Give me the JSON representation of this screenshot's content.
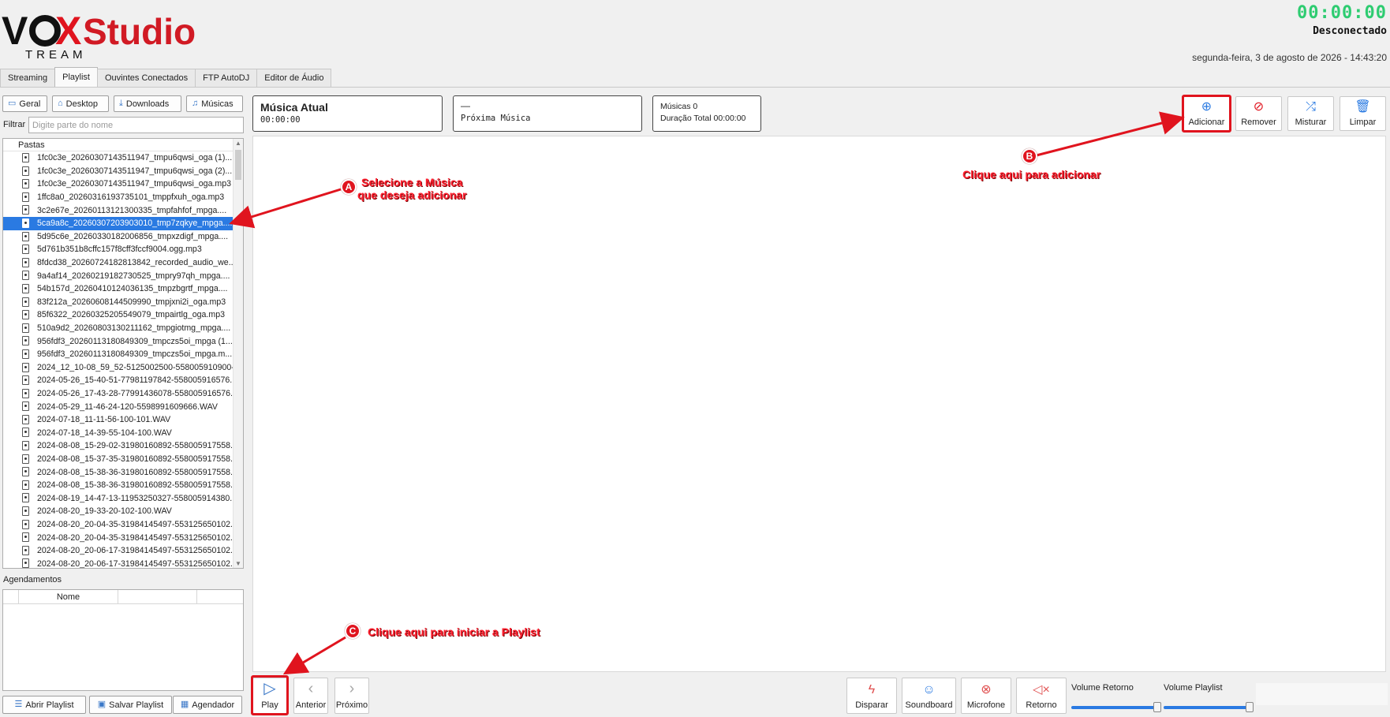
{
  "brand": {
    "name": "VOX Studio",
    "sub": "TREAM"
  },
  "status": {
    "clock": "00:00:00",
    "connection": "Desconectado",
    "datetime": "segunda-feira, 3 de agosto de 2026 - 14:43:20"
  },
  "tabs": [
    "Streaming",
    "Playlist",
    "Ouvintes Conectados",
    "FTP AutoDJ",
    "Editor de Áudio"
  ],
  "folders": {
    "general": "Geral",
    "desktop": "Desktop",
    "downloads": "Downloads",
    "music": "Músicas"
  },
  "filter": {
    "label": "Filtrar",
    "placeholder": "Digite parte do nome"
  },
  "tree": {
    "header": "Pastas",
    "files": [
      "1fc0c3e_20260307143511947_tmpu6qwsi_oga (1)....",
      "1fc0c3e_20260307143511947_tmpu6qwsi_oga (2)....",
      "1fc0c3e_20260307143511947_tmpu6qwsi_oga.mp3",
      "1ffc8a0_20260316193735101_tmppfxuh_oga.mp3",
      "3c2e67e_20260113121300335_tmpfahfof_mpga....",
      "5ca9a8c_20260307203903010_tmp7zqkye_mpga....",
      "5d95c6e_20260330182006856_tmpxzdigf_mpga....",
      "5d761b351b8cffc157f8cff3fccf9004.ogg.mp3",
      "8fdcd38_20260724182813842_recorded_audio_we...",
      "9a4af14_20260219182730525_tmpry97qh_mpga....",
      "54b157d_20260410124036135_tmpzbgrtf_mpga....",
      "83f212a_20260608144509990_tmpjxni2i_oga.mp3",
      "85f6322_20260325205549079_tmpairtlg_oga.mp3",
      "510a9d2_20260803130211162_tmpgiotmg_mpga....",
      "956fdf3_20260113180849309_tmpczs5oi_mpga (1...",
      "956fdf3_20260113180849309_tmpczs5oi_mpga.m...",
      "2024_12_10-08_59_52-5125002500-558005910900-...",
      "2024-05-26_15-40-51-77981197842-558005916576...",
      "2024-05-26_17-43-28-77991436078-558005916576...",
      "2024-05-29_11-46-24-120-5598991609666.WAV",
      "2024-07-18_11-11-56-100-101.WAV",
      "2024-07-18_14-39-55-104-100.WAV",
      "2024-08-08_15-29-02-31980160892-558005917558...",
      "2024-08-08_15-37-35-31980160892-558005917558...",
      "2024-08-08_15-38-36-31980160892-558005917558...",
      "2024-08-08_15-38-36-31980160892-558005917558...",
      "2024-08-19_14-47-13-11953250327-558005914380...",
      "2024-08-20_19-33-20-102-100.WAV",
      "2024-08-20_20-04-35-31984145497-553125650102...",
      "2024-08-20_20-04-35-31984145497-553125650102...",
      "2024-08-20_20-06-17-31984145497-553125650102...",
      "2024-08-20_20-06-17-31984145497-553125650102..."
    ],
    "selected_index": 5
  },
  "schedules": {
    "label": "Agendamentos",
    "col_name": "Nome"
  },
  "bottom_left": {
    "open": "Abrir Playlist",
    "save": "Salvar Playlist",
    "scheduler": "Agendador"
  },
  "now_playing": {
    "title": "Música Atual",
    "time": "00:00:00"
  },
  "next": {
    "dash": "—",
    "label": "Próxima Música"
  },
  "totals": {
    "count": "Músicas 0",
    "duration": "Duração Total 00:00:00"
  },
  "actions": {
    "add": "Adicionar",
    "remove": "Remover",
    "shuffle": "Misturar",
    "clear": "Limpar"
  },
  "transport": {
    "play": "Play",
    "prev": "Anterior",
    "next": "Próximo"
  },
  "media": {
    "trigger": "Disparar",
    "soundboard": "Soundboard",
    "mic": "Microfone",
    "return": "Retorno"
  },
  "volumes": {
    "return_label": "Volume Retorno",
    "return_level": 1.0,
    "playlist_label": "Volume Playlist",
    "playlist_level": 1.0
  },
  "annotations": {
    "a_badge": "A",
    "a_line1": "Selecione a Música",
    "a_line2": "que deseja adicionar",
    "b_badge": "B",
    "b_text": "Clique aqui para adicionar",
    "c_badge": "C",
    "c_text": "Clique aqui para iniciar a Playlist"
  },
  "colors": {
    "accent": "#2a7ae2",
    "clock": "#2ecc71",
    "logo_red": "#e0141e",
    "annotation": "#e0141e"
  }
}
